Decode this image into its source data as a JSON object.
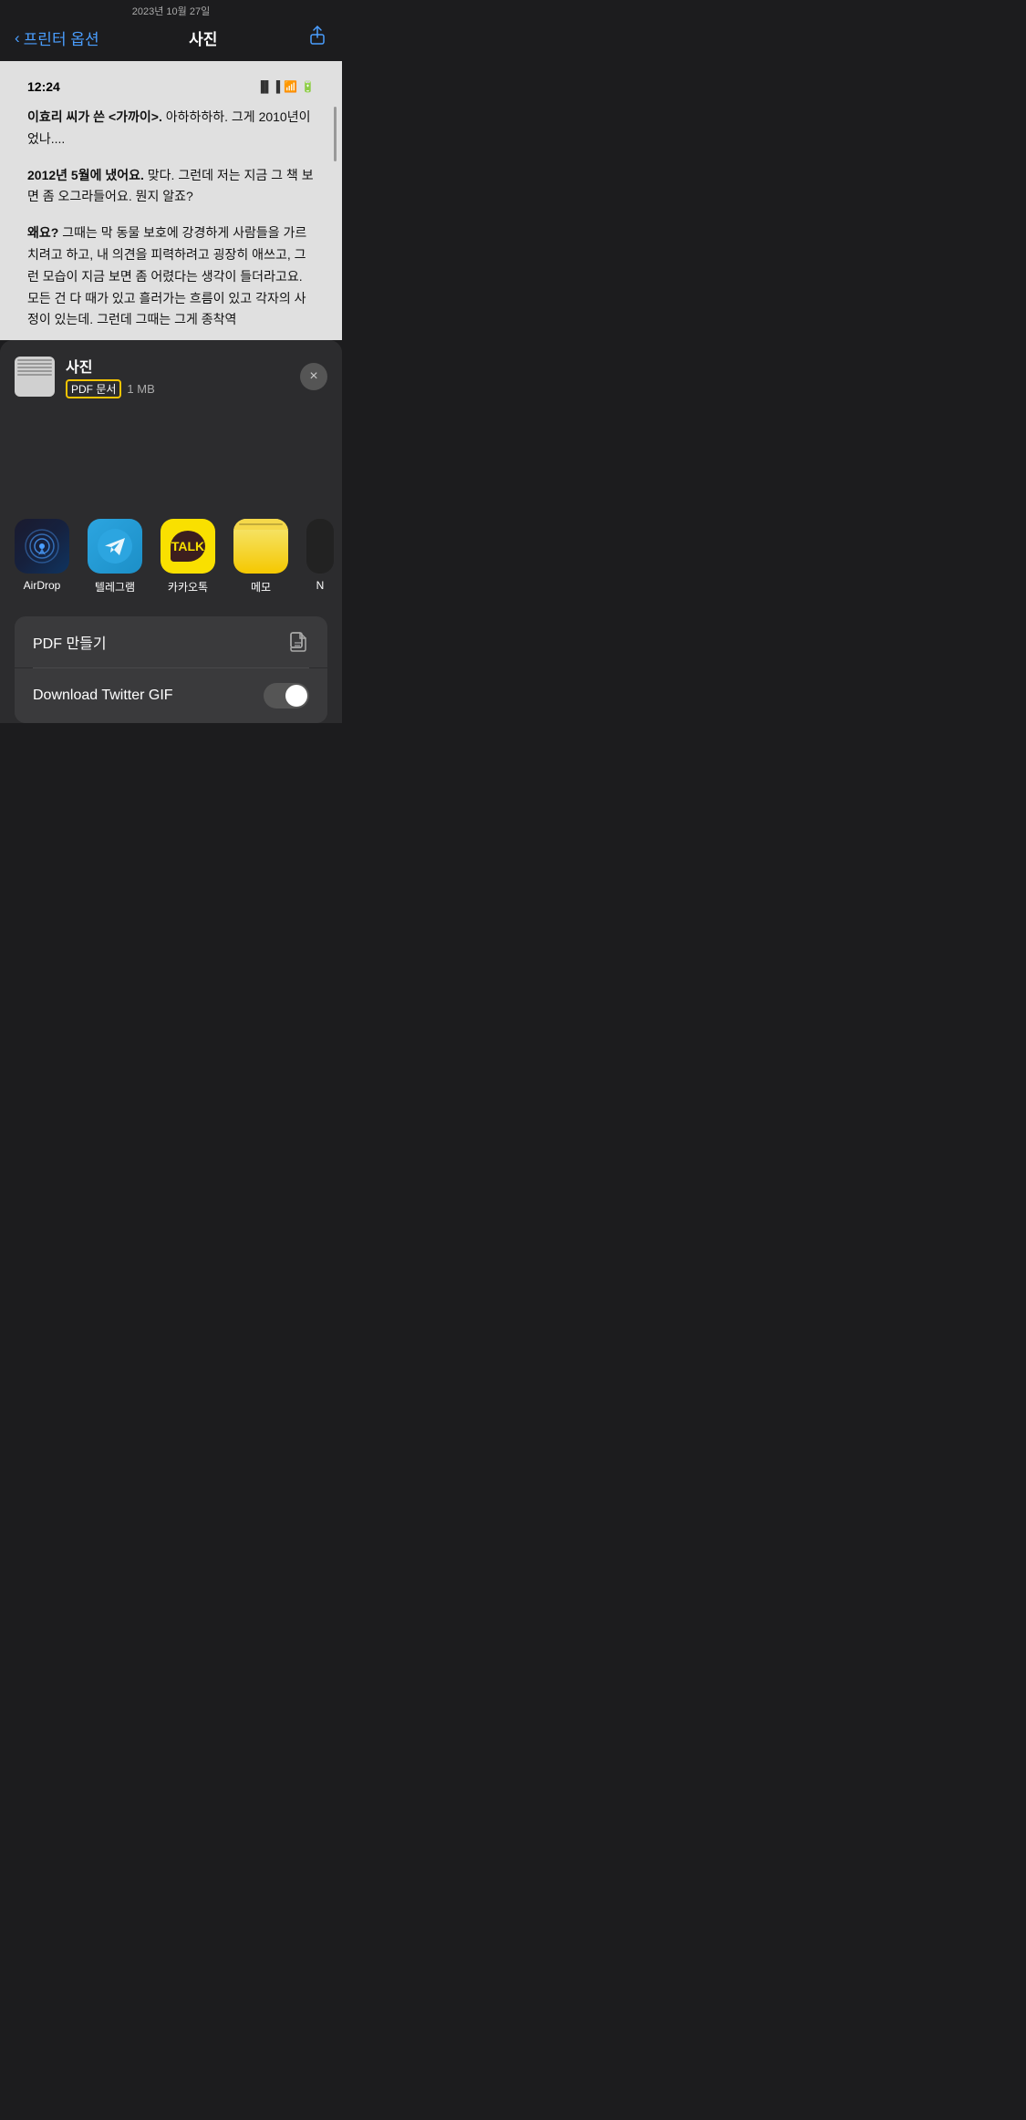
{
  "statusBar": {
    "date": "2023년 10월 27일"
  },
  "navBar": {
    "backLabel": "프린터 옵션",
    "title": "사진",
    "shareIcon": "↑"
  },
  "docPreview": {
    "time": "12:24",
    "paragraph1": "이효리 씨가 쓴 <가까이>. 아하하하하. 그게 2010년이었나....",
    "paragraph2": "2012년 5월에 냈어요. 맞다. 그런데 저는 지금 그 책 보면 좀 오그라들어요. 뭔지 알죠?",
    "paragraph3": "왜요? 그때는 막 동물 보호에 강경하게 사람들을 가르치려고 하고, 내 의견을 피력하려고 굉장히 애쓰고, 그런 모습이 지금 보면 좀 어렸다는 생각이 들더라고요. 모든 건 다 때가 있고 흘러가는 흐름이 있고 각자의 사정이 있는데. 그런데 그때는 그게 종착역"
  },
  "fileInfo": {
    "name": "사진",
    "type": "PDF 문서",
    "size": "1 MB"
  },
  "apps": [
    {
      "id": "airdrop",
      "label": "AirDrop",
      "type": "airdrop"
    },
    {
      "id": "telegram",
      "label": "텔레그램",
      "type": "telegram"
    },
    {
      "id": "kakao",
      "label": "카카오톡",
      "type": "kakao"
    },
    {
      "id": "memo",
      "label": "메모",
      "type": "memo"
    },
    {
      "id": "unknown",
      "label": "N",
      "type": "unknown"
    }
  ],
  "actions": [
    {
      "id": "pdf",
      "label": "PDF 만들기",
      "icon": "📄",
      "type": "icon"
    },
    {
      "id": "twitter",
      "label": "Download Twitter GIF",
      "icon": "toggle",
      "type": "toggle"
    }
  ],
  "closeButton": "×"
}
